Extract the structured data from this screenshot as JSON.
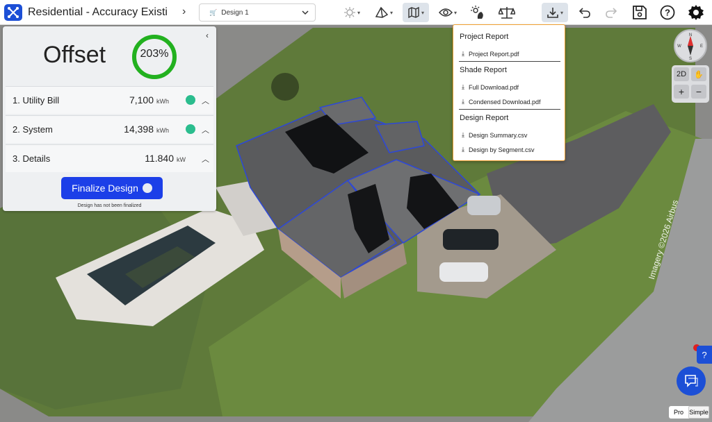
{
  "app": {
    "project_title": "Residential - Accuracy Existi",
    "design_select": "Design 1"
  },
  "toolbar": {
    "icons": [
      "sun-icon",
      "roof-icon",
      "map-icon",
      "eye-icon",
      "shade-icon",
      "scale-icon",
      "download-icon",
      "undo-icon",
      "redo-icon",
      "save-icon",
      "help-icon",
      "settings-icon"
    ]
  },
  "panel": {
    "offset_label": "Offset",
    "offset_percent": "203%",
    "offset_fraction": 1.0,
    "rows": [
      {
        "label": "1. Utility Bill",
        "value": "7,100",
        "unit": "kWh",
        "checked": true
      },
      {
        "label": "2. System",
        "value": "14,398",
        "unit": "kWh",
        "checked": true
      },
      {
        "label": "3. Details",
        "value": "11.840",
        "unit": "kW",
        "checked": false
      }
    ],
    "finalize_label": "Finalize Design",
    "finalize_note": "Design has not been finalized"
  },
  "download_menu": {
    "sections": [
      {
        "title": "Project Report",
        "items": [
          "Project Report.pdf"
        ]
      },
      {
        "title": "Shade Report",
        "items": [
          "Full Download.pdf",
          "Condensed Download.pdf"
        ]
      },
      {
        "title": "Design Report",
        "items": [
          "Design Summary.csv",
          "Design by Segment.csv"
        ]
      }
    ]
  },
  "map_controls": {
    "compass": {
      "n": "N",
      "e": "E",
      "s": "S",
      "w": "W"
    },
    "view_2d": "2D",
    "zoom_in": "+",
    "zoom_out": "−"
  },
  "mode_toggle": {
    "pro": "Pro",
    "simple": "Simple"
  },
  "watermark": "Imagery ©2026 Airbus",
  "colors": {
    "brand": "#1c4fd6",
    "accent_ring": "#22b11f",
    "check": "#2bbd8e",
    "dropdown_border": "#f0a030",
    "roof_outline": "#2d48d8"
  }
}
